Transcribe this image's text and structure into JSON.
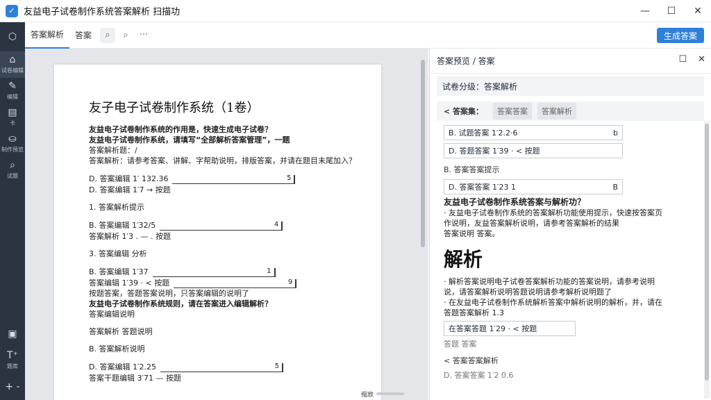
{
  "window": {
    "title": "友益电子试卷制作系统答案解析 扫描功",
    "logo": "✓",
    "controls": {
      "minimize": "—",
      "maximize": "☐",
      "close": "✕"
    }
  },
  "rail": {
    "top_icon": "⬡",
    "items": [
      {
        "icon": "⌂",
        "label": "试卷编辑"
      },
      {
        "icon": "✎",
        "label": "编辑"
      },
      {
        "icon": "▤",
        "label": "卡"
      },
      {
        "icon": "⛀",
        "label": "制作预览"
      },
      {
        "icon": "⌕",
        "label": "试题"
      }
    ],
    "bottom": [
      {
        "icon": "▣",
        "label": ""
      },
      {
        "icon": "T⁺",
        "label": "题库"
      },
      {
        "icon": "+ -",
        "label": ""
      }
    ]
  },
  "toolbar": {
    "tab_active": "答案解析",
    "tab2": "答案",
    "icons": [
      "⌕",
      "⌕",
      "···"
    ],
    "primary": "生成答案"
  },
  "document": {
    "title": "友子电子试卷制作系统（1卷）",
    "lines1": [
      "友益电子试卷制作系统的作用是，快速生成电子试卷？",
      "友益电子试卷制作系统，请填写“全部解析答案管理”，一题",
      "答案解析题：/",
      "答案解析：请参考答案、讲解、字帮助说明，排版答案，并请在题目末尾加入？"
    ],
    "field1a": {
      "text": "D. 答案编辑 1′ 132.36",
      "end": "5"
    },
    "field1b": {
      "text": "D. 答案编辑 1′7  →  按题",
      "end": ""
    },
    "section2": "1. 答案解析提示",
    "field2a": {
      "text": "B. 答案编辑 1′32/5",
      "end": "4"
    },
    "field2b": {
      "text": "答案解析 1′3 . — . 按题",
      "end": ""
    },
    "section3": "3. 答案编辑 分析",
    "field3a": {
      "text": "B. 答案编辑 1′37",
      "end": "1"
    },
    "field3b": {
      "text": "答案编辑 1′39  ·  < 按题",
      "end": "9"
    },
    "lines2": [
      "按题答案，答题答案说明，只答案编辑的说明了",
      "友益电子试卷制作系统规则，请在答案进入编辑解析？",
      "答案编辑说明"
    ],
    "section4": "答案解析 答题说明",
    "section5": "B. 答案解析说明",
    "field5a": {
      "text": "D. 答案编辑 1′2.25",
      "end": "5"
    },
    "field5b": {
      "text": "答案干题编辑 3′71  —  按题",
      "end": ""
    },
    "zoom": "缩放"
  },
  "pane": {
    "header": "答案预览 / 答案",
    "header_icons": [
      "☐",
      "✕"
    ],
    "sub": "试卷分级：答案解析",
    "tabs": {
      "back": "< 答案集：",
      "t1": "答案答案",
      "t2": "答案解析"
    },
    "field_a": {
      "text": "B. 试题答案 1′2.2·6",
      "end": "b"
    },
    "field_b": {
      "text": "D. 答题答案 1′39  ·  < 按题",
      "end": ""
    },
    "sec1": "B. 答案答案提示",
    "field_c": {
      "text": "D. 答案答案 1′23 1",
      "end": "B"
    },
    "q_title": "友益电子试卷制作系统答案与解析功？",
    "q_lines": [
      "· 友益电子试卷制作系统的答案解析功能使用提示，快速按答案页",
      "  作说明，友益答案解析说明，请参考答案解析的结果",
      "  答案说明 答案。"
    ],
    "big": "解析",
    "a_lines": [
      "· 解析答案说明电子试卷答案解析功能的答案说明，请参考说明",
      "  说，请答案解析说明答题说明请参考解析说明题了",
      "· 在友益电子试卷制作系统解析答案中解析说明的解析，并，请在",
      "  答题答案解析 1.3"
    ],
    "field_d": {
      "text": "在答案答题 1′29  ·  < 按题",
      "end": ""
    },
    "muted": "答题 答案",
    "sec2": "< 答案答案解析",
    "tail": "D. 答案答案 1′2 0.6"
  }
}
